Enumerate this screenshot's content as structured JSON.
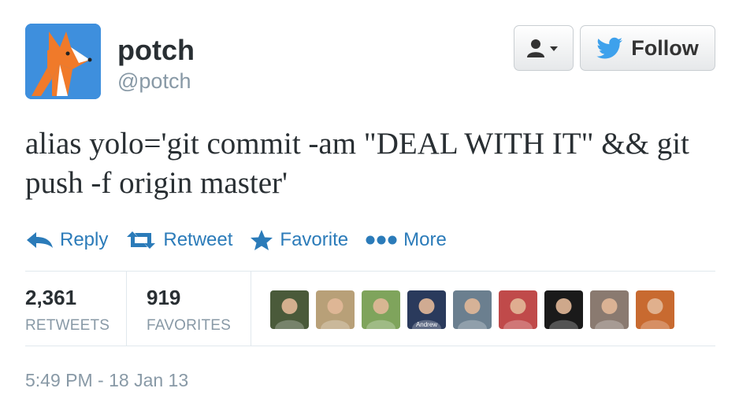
{
  "user": {
    "name": "potch",
    "screen_name": "@potch"
  },
  "follow_button": {
    "label": "Follow"
  },
  "tweet": {
    "text": "alias yolo='git commit -am \"DEAL WITH IT\" && git push -f origin master'"
  },
  "actions": {
    "reply": "Reply",
    "retweet": "Retweet",
    "favorite": "Favorite",
    "more": "More"
  },
  "stats": {
    "retweets_count": "2,361",
    "retweets_label": "RETWEETS",
    "favorites_count": "919",
    "favorites_label": "FAVORITES"
  },
  "faces": [
    {
      "name": "face-1",
      "color": "#4a5a3a"
    },
    {
      "name": "face-2",
      "color": "#b8a078"
    },
    {
      "name": "face-3",
      "color": "#7fa45c"
    },
    {
      "name": "face-4",
      "color": "#2a3a5c",
      "caption": "Andrew"
    },
    {
      "name": "face-5",
      "color": "#6b7f8f"
    },
    {
      "name": "face-6",
      "color": "#c04a4a"
    },
    {
      "name": "face-7",
      "color": "#1a1a1a"
    },
    {
      "name": "face-8",
      "color": "#8a7a70"
    },
    {
      "name": "face-9",
      "color": "#c86a30"
    }
  ],
  "timestamp": "5:49 PM - 18 Jan 13",
  "colors": {
    "link_blue": "#2b7bb9",
    "muted_gray": "#8899a6",
    "avatar_bg": "#3e8fdd",
    "fox_orange": "#f07a2a"
  },
  "icons": {
    "avatar": "fox-logo",
    "user_dropdown": "user-icon",
    "follow": "bird-icon",
    "reply": "reply-arrow-icon",
    "retweet": "retweet-icon",
    "favorite": "star-icon",
    "more": "dots-icon"
  }
}
